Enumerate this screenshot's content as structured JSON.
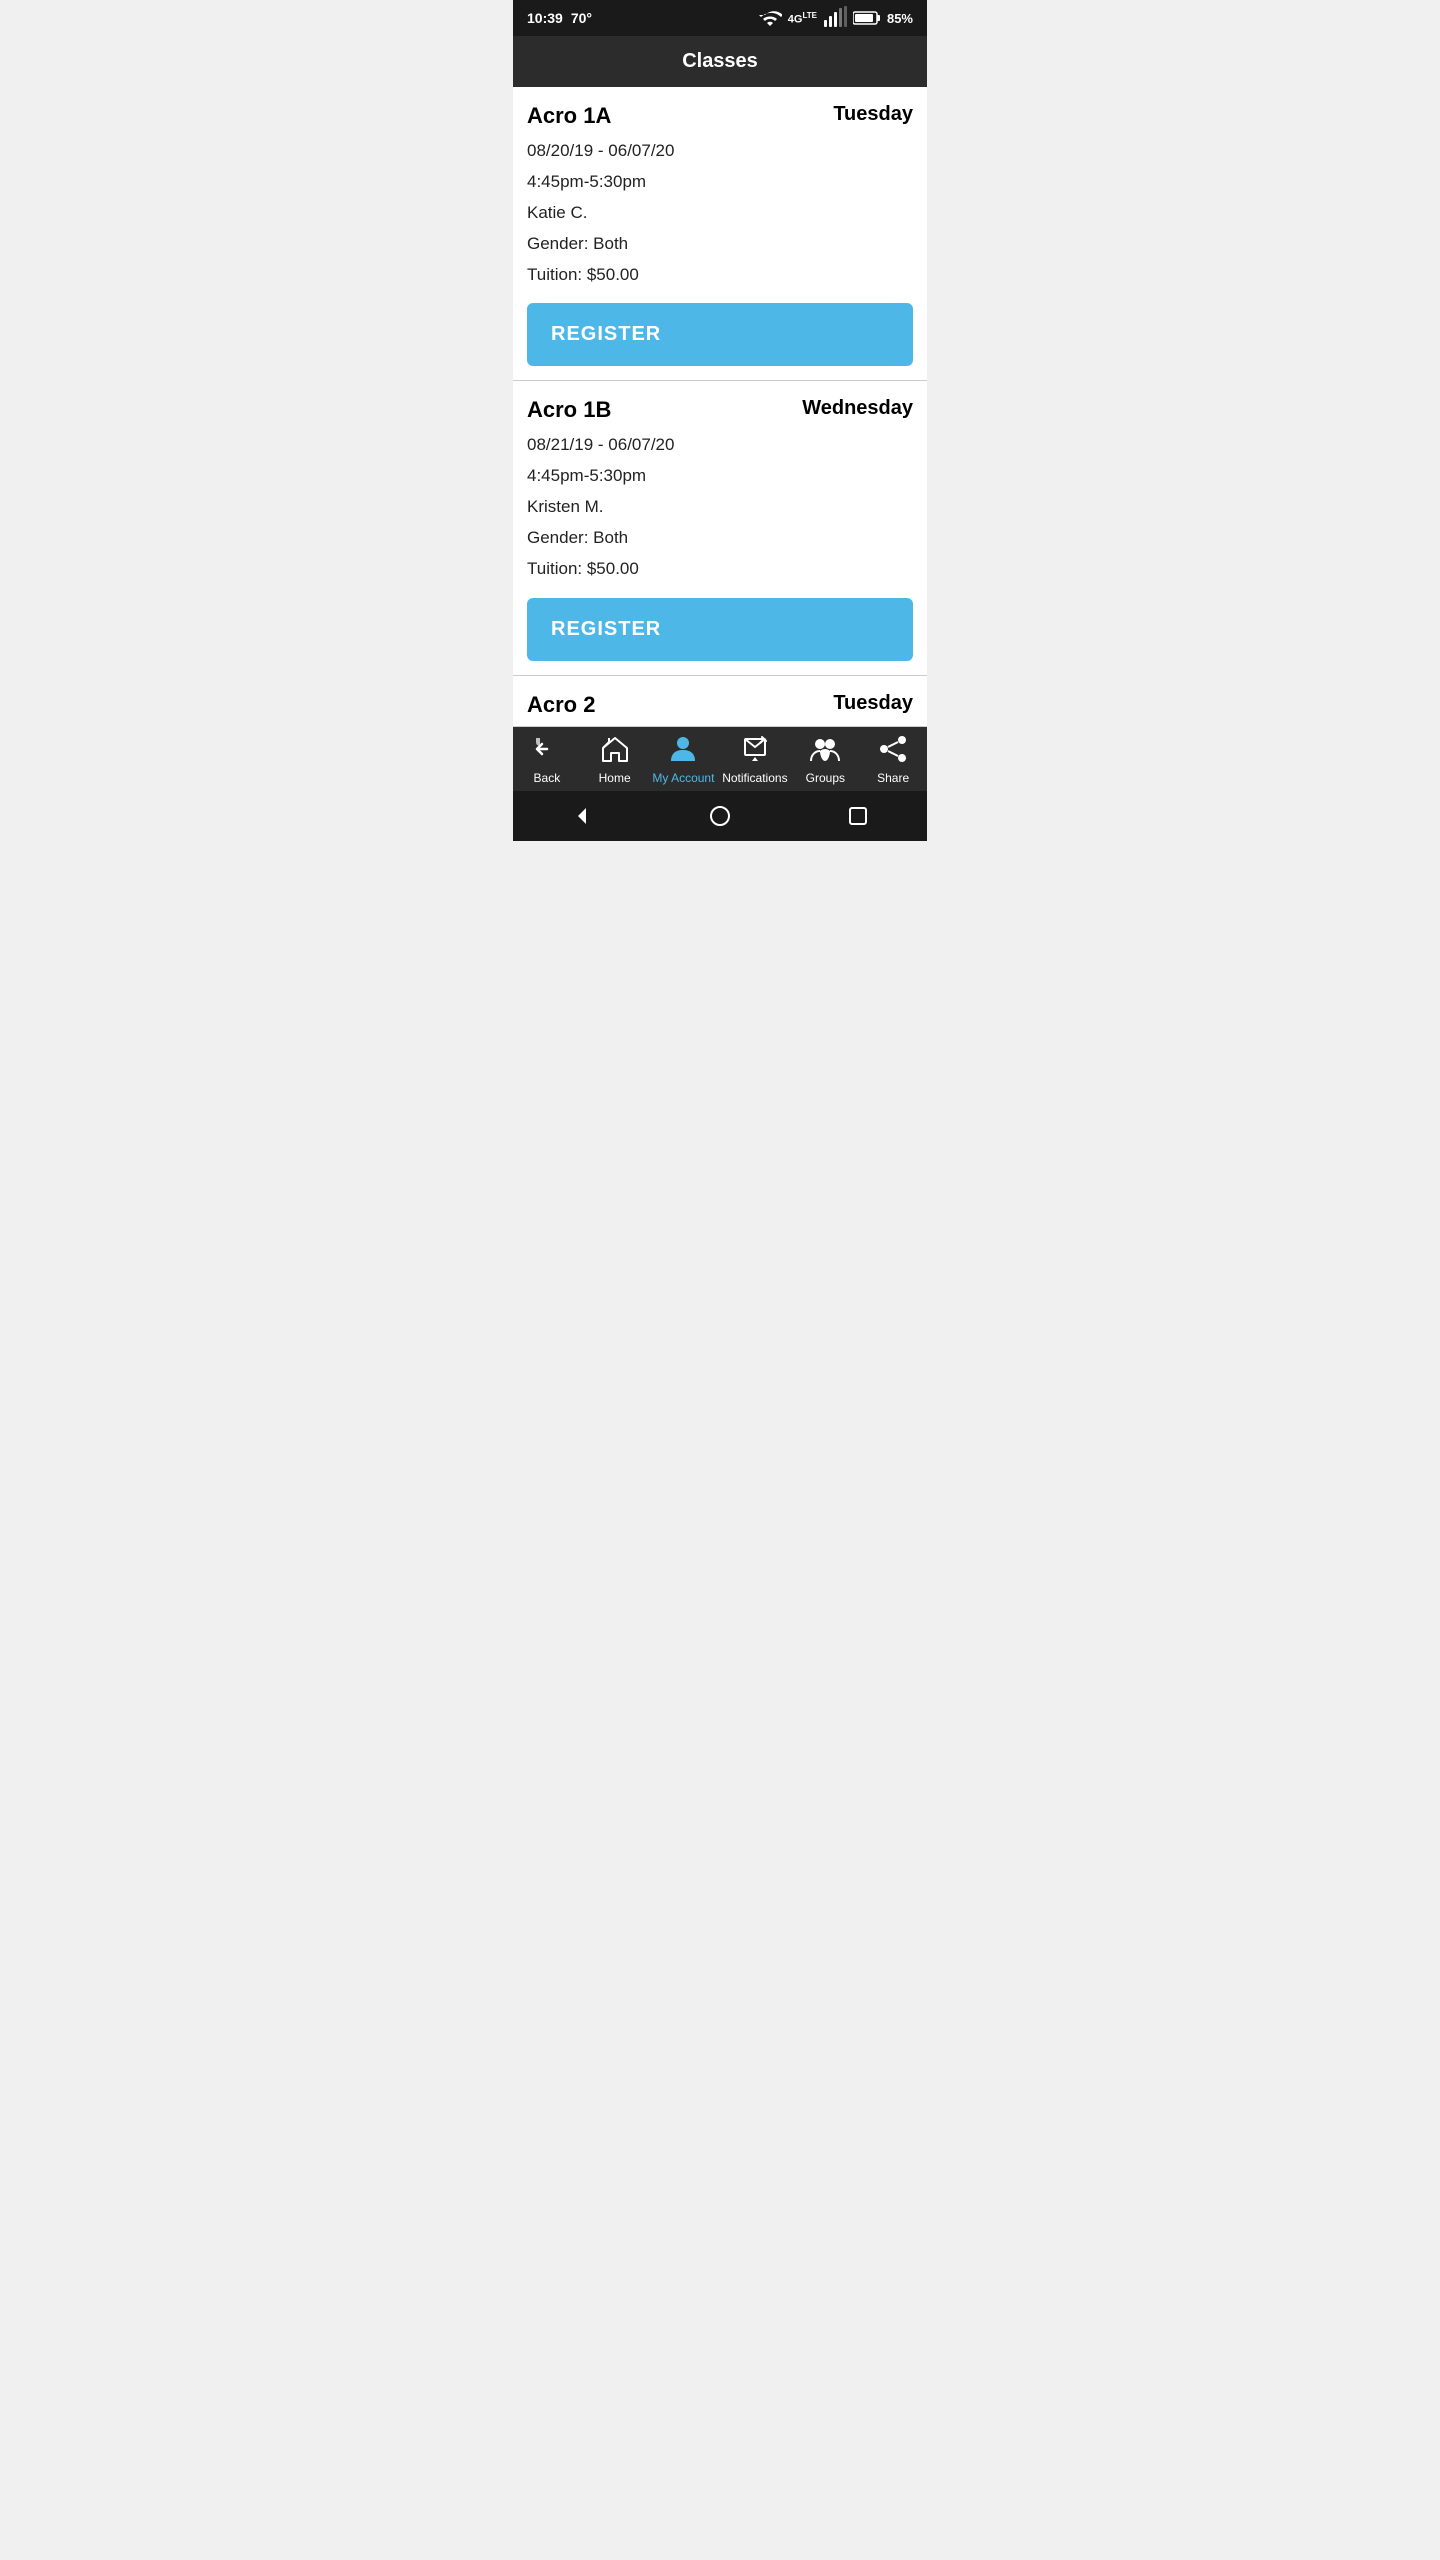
{
  "statusBar": {
    "time": "10:39",
    "temperature": "70°",
    "battery": "85%"
  },
  "header": {
    "title": "Classes"
  },
  "classes": [
    {
      "name": "Acro 1A",
      "day": "Tuesday",
      "dateRange": "08/20/19 - 06/07/20",
      "timeRange": "4:45pm-5:30pm",
      "instructor": "Katie C.",
      "gender": "Gender: Both",
      "tuition": "Tuition: $50.00",
      "registerLabel": "REGISTER"
    },
    {
      "name": "Acro 1B",
      "day": "Wednesday",
      "dateRange": "08/21/19 - 06/07/20",
      "timeRange": "4:45pm-5:30pm",
      "instructor": "Kristen M.",
      "gender": "Gender: Both",
      "tuition": "Tuition: $50.00",
      "registerLabel": "REGISTER"
    },
    {
      "name": "Acro 2",
      "day": "Tuesday",
      "dateRange": "",
      "timeRange": "",
      "instructor": "",
      "gender": "",
      "tuition": "",
      "registerLabel": ""
    }
  ],
  "bottomNav": {
    "items": [
      {
        "id": "back",
        "label": "Back",
        "active": false
      },
      {
        "id": "home",
        "label": "Home",
        "active": false
      },
      {
        "id": "myaccount",
        "label": "My Account",
        "active": true
      },
      {
        "id": "notifications",
        "label": "Notifications",
        "active": false
      },
      {
        "id": "groups",
        "label": "Groups",
        "active": false
      },
      {
        "id": "share",
        "label": "Share",
        "active": false
      }
    ]
  }
}
